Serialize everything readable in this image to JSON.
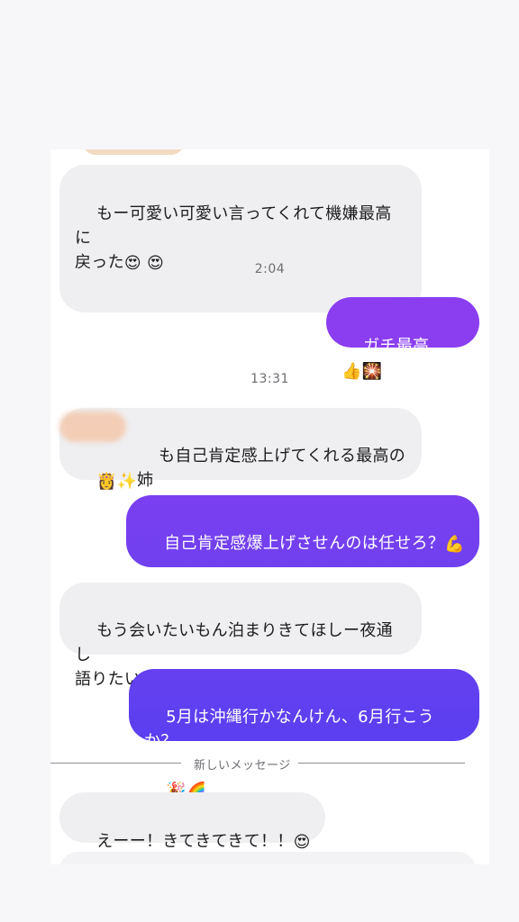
{
  "conversation": {
    "messages": [
      {
        "id": "m1",
        "direction": "incoming",
        "text": "もー可愛い可愛い言ってくれて機嫌最高に\n戻った",
        "emoji": "😍 😍"
      },
      {
        "id": "t1",
        "type": "timestamp",
        "text": "2:04"
      },
      {
        "id": "m2",
        "direction": "outgoing",
        "text": "ガチ最高",
        "emoji": "👍🎇"
      },
      {
        "id": "t2",
        "type": "timestamp",
        "text": "13:31"
      },
      {
        "id": "m3",
        "direction": "incoming",
        "text": "も自己肯定感上げてくれる最高の姉",
        "emoji": "👸✨"
      },
      {
        "id": "m4",
        "direction": "outgoing",
        "text": "自己肯定感爆上げさせんのは任せろ？",
        "emoji": "💪",
        "emoji2": "😎"
      },
      {
        "id": "m5",
        "direction": "incoming",
        "text": "もう会いたいもん泊まりきてほしー夜通し\n語りたい",
        "emoji": "😭😭😭"
      },
      {
        "id": "m6",
        "direction": "outgoing",
        "text": "5月は沖縄行かなんけん、6月行こうか？",
        "emoji": "🎉🌈"
      },
      {
        "id": "m7",
        "direction": "incoming",
        "text": "えーー！きてきてきて！！",
        "emoji": "😍"
      }
    ],
    "new_messages_divider": "新しいメッセージ"
  },
  "colors": {
    "incoming_bubble": "#efeff1",
    "outgoing_top": "#8b3ef0",
    "outgoing_bottom": "#5b3ff0",
    "background": "#ffffff"
  }
}
